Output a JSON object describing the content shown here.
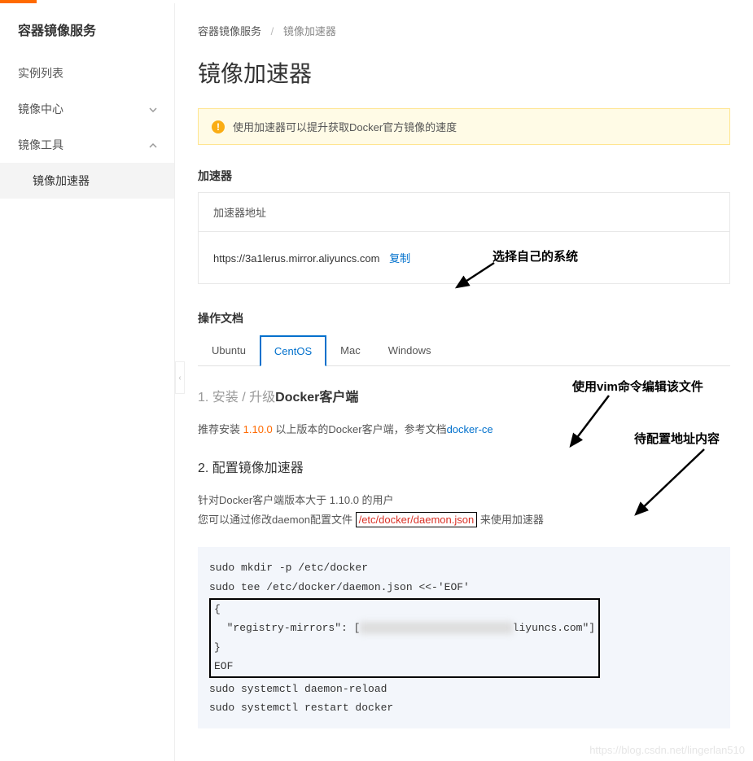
{
  "sidebar": {
    "title": "容器镜像服务",
    "items": [
      {
        "label": "实例列表",
        "expandable": false
      },
      {
        "label": "镜像中心",
        "expandable": true,
        "open": false
      },
      {
        "label": "镜像工具",
        "expandable": true,
        "open": true,
        "children": [
          {
            "label": "镜像加速器",
            "active": true
          }
        ]
      }
    ]
  },
  "breadcrumb": {
    "part1": "容器镜像服务",
    "sep": "/",
    "part2": "镜像加速器"
  },
  "page_title": "镜像加速器",
  "alert": {
    "text": "使用加速器可以提升获取Docker官方镜像的速度"
  },
  "accelerator": {
    "section_label": "加速器",
    "card_header": "加速器地址",
    "url": "https://3a1lerus.mirror.aliyuncs.com",
    "copy_label": "复制"
  },
  "docs": {
    "section_label": "操作文档",
    "tabs": [
      "Ubuntu",
      "CentOS",
      "Mac",
      "Windows"
    ],
    "active_tab_index": 1
  },
  "step1": {
    "title_prefix": "1. 安装 / 升级",
    "title_bold": "Docker客户端",
    "desc_pre": "推荐安装 ",
    "version": "1.10.0",
    "desc_mid": " 以上版本的Docker客户端，参考文档",
    "link_text": "docker-ce"
  },
  "step2": {
    "title": "2. 配置镜像加速器",
    "desc_line1": "针对Docker客户端版本大于 1.10.0 的用户",
    "desc_line2_pre": "您可以通过修改daemon配置文件 ",
    "daemon_path": "/etc/docker/daemon.json",
    "desc_line2_post": " 来使用加速器"
  },
  "code": {
    "line1": "sudo mkdir -p /etc/docker",
    "line2": "sudo tee /etc/docker/daemon.json <<-'EOF'",
    "json_open": "{",
    "json_mirror_key": "  \"registry-mirrors\": [",
    "json_mirror_blur": "\"https://xxxxxx.mirror.a",
    "json_mirror_tail": "liyuncs.com\"]",
    "json_close": "}",
    "eof": "EOF",
    "line_reload": "sudo systemctl daemon-reload",
    "line_restart": "sudo systemctl restart docker"
  },
  "annotations": {
    "ann_tab": "选择自己的系统",
    "ann_vim": "使用vim命令编辑该文件",
    "ann_addr": "待配置地址内容"
  },
  "watermark": "https://blog.csdn.net/lingerlan510",
  "collapse_glyph": "‹"
}
